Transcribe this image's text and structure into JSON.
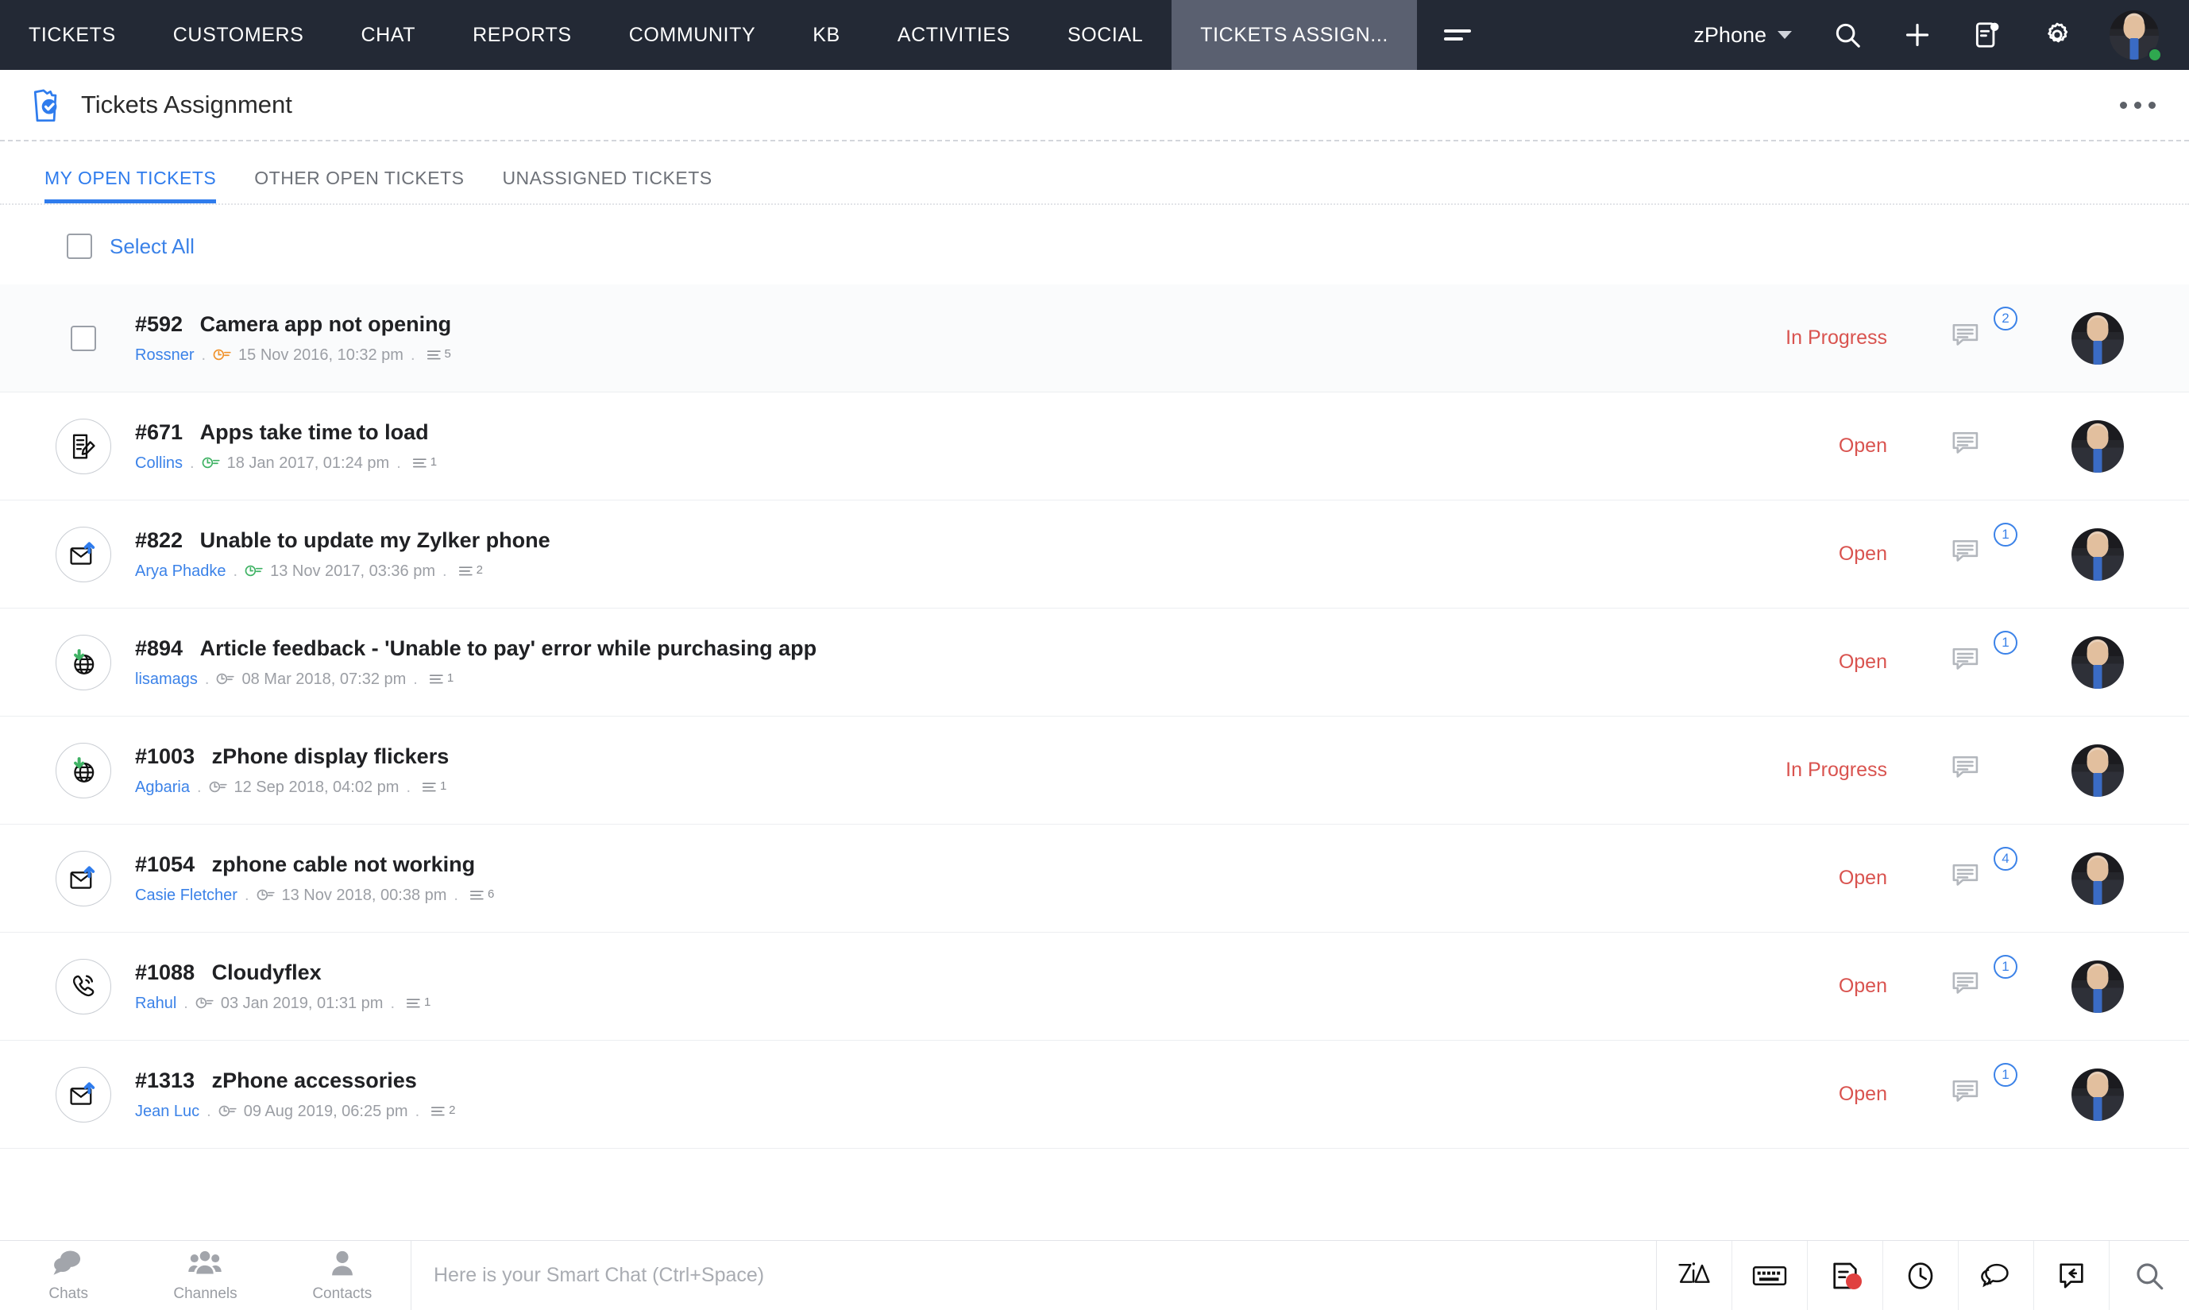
{
  "topnav": {
    "items": [
      {
        "label": "TICKETS",
        "active": false
      },
      {
        "label": "CUSTOMERS",
        "active": false
      },
      {
        "label": "CHAT",
        "active": false
      },
      {
        "label": "REPORTS",
        "active": false
      },
      {
        "label": "COMMUNITY",
        "active": false
      },
      {
        "label": "KB",
        "active": false
      },
      {
        "label": "ACTIVITIES",
        "active": false
      },
      {
        "label": "SOCIAL",
        "active": false
      },
      {
        "label": "TICKETS ASSIGN...",
        "active": true
      }
    ],
    "department": "zPhone",
    "icons": [
      "hamburger-icon",
      "search-icon",
      "add-icon",
      "notifications-icon",
      "settings-gear-icon",
      "user-avatar"
    ],
    "background": "#232935",
    "active_tab_background": "#5a6070"
  },
  "page_header": {
    "title": "Tickets Assignment",
    "logo": "tickets-assignment-logo",
    "more_menu": "more-options"
  },
  "tabs": [
    {
      "label": "MY OPEN TICKETS",
      "active": true
    },
    {
      "label": "OTHER OPEN TICKETS",
      "active": false
    },
    {
      "label": "UNASSIGNED TICKETS",
      "active": false
    }
  ],
  "select_all": {
    "label": "Select All",
    "checked": false
  },
  "accent_color": "#2f7ced",
  "status_color": "#d9534f",
  "link_color": "#3b82e8",
  "tickets": [
    {
      "id": "#592",
      "subject": "Camera app not opening",
      "contact": "Rossner",
      "timestamp": "15 Nov 2016, 10:32 pm",
      "thread_count": "5",
      "status": "In Progress",
      "comment_count": "2",
      "channel": "checkbox",
      "sla_color": "#f0922b",
      "selected_row": true,
      "has_checkbox": true
    },
    {
      "id": "#671",
      "subject": "Apps take time to load",
      "contact": "Collins",
      "timestamp": "18 Jan 2017, 01:24 pm",
      "thread_count": "1",
      "status": "Open",
      "comment_count": "",
      "channel": "web-form",
      "sla_color": "#3fb264",
      "selected_row": false,
      "has_checkbox": false
    },
    {
      "id": "#822",
      "subject": "Unable to update my Zylker phone",
      "contact": "Arya Phadke",
      "timestamp": "13 Nov 2017, 03:36 pm",
      "thread_count": "2",
      "status": "Open",
      "comment_count": "1",
      "channel": "email",
      "sla_color": "#3fb264",
      "selected_row": false,
      "has_checkbox": false
    },
    {
      "id": "#894",
      "subject": "Article feedback - 'Unable to pay' error while purchasing app",
      "contact": "lisamags",
      "timestamp": "08 Mar 2018, 07:32 pm",
      "thread_count": "1",
      "status": "Open",
      "comment_count": "1",
      "channel": "web",
      "sla_color": "#9b9ea4",
      "selected_row": false,
      "has_checkbox": false
    },
    {
      "id": "#1003",
      "subject": "zPhone display flickers",
      "contact": "Agbaria",
      "timestamp": "12 Sep 2018, 04:02 pm",
      "thread_count": "1",
      "status": "In Progress",
      "comment_count": "",
      "channel": "web",
      "sla_color": "#9b9ea4",
      "selected_row": false,
      "has_checkbox": false
    },
    {
      "id": "#1054",
      "subject": "zphone cable not working",
      "contact": "Casie Fletcher",
      "timestamp": "13 Nov 2018, 00:38 pm",
      "thread_count": "6",
      "status": "Open",
      "comment_count": "4",
      "channel": "email",
      "sla_color": "#9b9ea4",
      "selected_row": false,
      "has_checkbox": false
    },
    {
      "id": "#1088",
      "subject": "Cloudyflex",
      "contact": "Rahul",
      "timestamp": "03 Jan 2019, 01:31 pm",
      "thread_count": "1",
      "status": "Open",
      "comment_count": "1",
      "channel": "phone",
      "sla_color": "#9b9ea4",
      "selected_row": false,
      "has_checkbox": false
    },
    {
      "id": "#1313",
      "subject": "zPhone accessories",
      "contact": "Jean Luc",
      "timestamp": "09 Aug 2019, 06:25 pm",
      "thread_count": "2",
      "status": "Open",
      "comment_count": "1",
      "channel": "email",
      "sla_color": "#9b9ea4",
      "selected_row": false,
      "has_checkbox": false
    }
  ],
  "bottombar": {
    "tabs": [
      {
        "label": "Chats",
        "icon": "chat-bubbles-icon"
      },
      {
        "label": "Channels",
        "icon": "people-group-icon"
      },
      {
        "label": "Contacts",
        "icon": "person-icon"
      }
    ],
    "chat_placeholder": "Here is your Smart Chat (Ctrl+Space)",
    "chat_value": "",
    "right_icons": [
      "zia-logo-icon",
      "keyboard-icon",
      "notes-icon",
      "clock-icon",
      "conversation-icon",
      "reply-icon",
      "search-icon"
    ]
  }
}
